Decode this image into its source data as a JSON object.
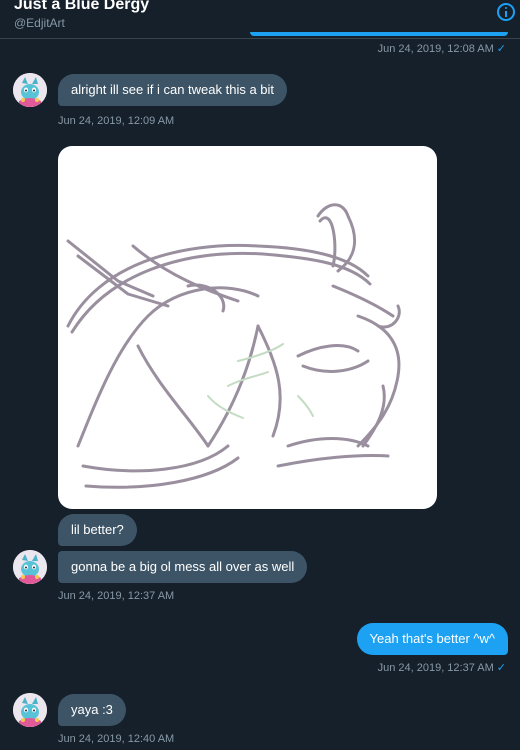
{
  "header": {
    "name": "Just a Blue Dergy",
    "handle": "@EdjitArt"
  },
  "messages": [
    {
      "id": "m0",
      "direction": "sent",
      "timestamp": "Jun 24, 2019, 12:08 AM",
      "status": "✓"
    },
    {
      "id": "m1",
      "direction": "received",
      "text": "alright ill see if i can tweak this a bit",
      "timestamp": "Jun 24, 2019, 12:09 AM"
    },
    {
      "id": "m2",
      "direction": "received",
      "type": "image"
    },
    {
      "id": "m3",
      "direction": "received",
      "text": "lil better?"
    },
    {
      "id": "m4",
      "direction": "received",
      "text": "gonna be a big ol mess all over as well",
      "timestamp": "Jun 24, 2019, 12:37 AM"
    },
    {
      "id": "m5",
      "direction": "sent",
      "text": "Yeah that's better ^w^",
      "timestamp": "Jun 24, 2019, 12:37 AM",
      "status": "✓"
    },
    {
      "id": "m6",
      "direction": "received",
      "text": "yaya :3",
      "timestamp": "Jun 24, 2019, 12:40 AM"
    }
  ],
  "icons": {
    "info": "info-icon",
    "read_receipt": "check-icon",
    "avatar": "avatar-image"
  },
  "colors": {
    "background": "#15202b",
    "received_bubble": "#3d5466",
    "sent_bubble": "#1da1f2",
    "timestamp": "#8899a6",
    "divider": "#38444d",
    "accent": "#1da1f2"
  }
}
